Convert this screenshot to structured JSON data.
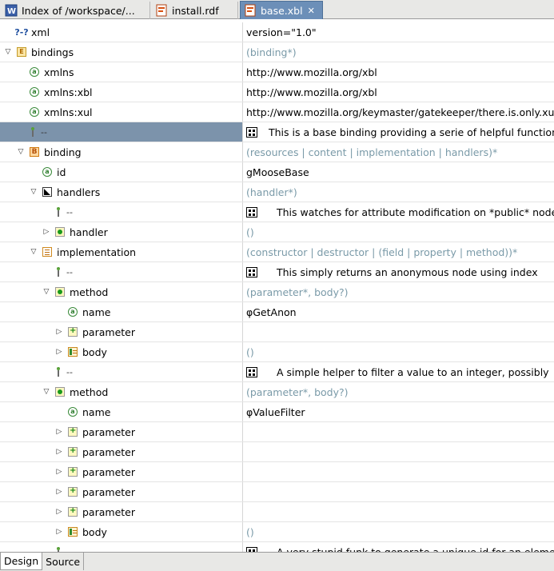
{
  "tabs": [
    {
      "label": "Index of /workspace/...",
      "icon": "html-page-icon"
    },
    {
      "label": "install.rdf",
      "icon": "xml-file-icon"
    },
    {
      "label": "base.xbl",
      "icon": "xml-file-icon",
      "active": true
    }
  ],
  "rows": [
    {
      "depth": 0,
      "twisty": "none",
      "icon": "pi",
      "label": "xml",
      "value": "version=\"1.0\""
    },
    {
      "depth": 0,
      "twisty": "open",
      "icon": "element-e",
      "label": "bindings",
      "value": "(binding*)",
      "muted": true
    },
    {
      "depth": 1,
      "twisty": "none",
      "icon": "attribute",
      "label": "xmlns",
      "value": "http://www.mozilla.org/xbl"
    },
    {
      "depth": 1,
      "twisty": "none",
      "icon": "attribute",
      "label": "xmlns:xbl",
      "value": "http://www.mozilla.org/xbl"
    },
    {
      "depth": 1,
      "twisty": "none",
      "icon": "attribute",
      "label": "xmlns:xul",
      "value": "http://www.mozilla.org/keymaster/gatekeeper/there.is.only.xul"
    },
    {
      "depth": 1,
      "twisty": "none",
      "icon": "comment",
      "label": "",
      "value": "This is a base binding providing a serie of helpful functions",
      "grid": true,
      "selected": true
    },
    {
      "depth": 1,
      "twisty": "open",
      "icon": "element-b",
      "label": "binding",
      "value": "(resources | content | implementation | handlers)*",
      "muted": true
    },
    {
      "depth": 2,
      "twisty": "none",
      "icon": "attribute",
      "label": "id",
      "value": "gMooseBase"
    },
    {
      "depth": 2,
      "twisty": "open",
      "icon": "choice",
      "label": "handlers",
      "value": "(handler*)",
      "muted": true
    },
    {
      "depth": 3,
      "twisty": "none",
      "icon": "comment",
      "label": "",
      "value": "This watches for attribute modification on *public* nodes",
      "grid": true,
      "indent": true
    },
    {
      "depth": 3,
      "twisty": "closed",
      "icon": "green-dot",
      "label": "handler",
      "value": "()",
      "muted": true
    },
    {
      "depth": 2,
      "twisty": "open",
      "icon": "list",
      "label": "implementation",
      "value": "(constructor | destructor | (field | property | method))*",
      "muted": true
    },
    {
      "depth": 3,
      "twisty": "none",
      "icon": "comment",
      "label": "",
      "value": "This simply returns an anonymous node using index",
      "grid": true,
      "indent": true
    },
    {
      "depth": 3,
      "twisty": "open",
      "icon": "green-dot",
      "label": "method",
      "value": "(parameter*, body?)",
      "muted": true
    },
    {
      "depth": 4,
      "twisty": "none",
      "icon": "attribute",
      "label": "name",
      "value": "φGetAnon"
    },
    {
      "depth": 4,
      "twisty": "closed",
      "icon": "plus",
      "label": "parameter",
      "value": ""
    },
    {
      "depth": 4,
      "twisty": "closed",
      "icon": "body",
      "label": "body",
      "value": "()",
      "muted": true
    },
    {
      "depth": 3,
      "twisty": "none",
      "icon": "comment",
      "label": "",
      "value": "A simple helper to filter a value to an integer, possibly",
      "grid": true,
      "indent": true
    },
    {
      "depth": 3,
      "twisty": "open",
      "icon": "green-dot",
      "label": "method",
      "value": "(parameter*, body?)",
      "muted": true
    },
    {
      "depth": 4,
      "twisty": "none",
      "icon": "attribute",
      "label": "name",
      "value": "φValueFilter"
    },
    {
      "depth": 4,
      "twisty": "closed",
      "icon": "plus",
      "label": "parameter",
      "value": ""
    },
    {
      "depth": 4,
      "twisty": "closed",
      "icon": "plus",
      "label": "parameter",
      "value": ""
    },
    {
      "depth": 4,
      "twisty": "closed",
      "icon": "plus",
      "label": "parameter",
      "value": ""
    },
    {
      "depth": 4,
      "twisty": "closed",
      "icon": "plus",
      "label": "parameter",
      "value": ""
    },
    {
      "depth": 4,
      "twisty": "closed",
      "icon": "plus",
      "label": "parameter",
      "value": ""
    },
    {
      "depth": 4,
      "twisty": "closed",
      "icon": "body",
      "label": "body",
      "value": "()",
      "muted": true
    },
    {
      "depth": 3,
      "twisty": "none",
      "icon": "comment",
      "label": "",
      "value": "A very stupid funk to generate a unique id for an element",
      "grid": true,
      "indent": true
    }
  ],
  "bottom_tabs": [
    {
      "label": "Design",
      "active": true
    },
    {
      "label": "Source",
      "active": false
    }
  ]
}
